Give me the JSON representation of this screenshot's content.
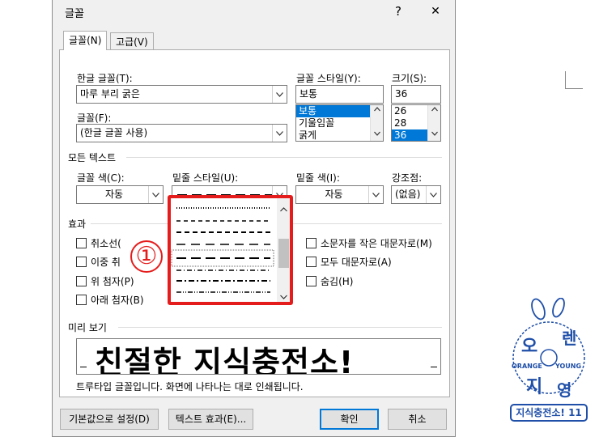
{
  "dialog": {
    "title": "글꼴",
    "help": "?",
    "close": "✕"
  },
  "tabs": [
    {
      "label": "글꼴(N)",
      "active": true
    },
    {
      "label": "고급(V)",
      "active": false
    }
  ],
  "hangul_font": {
    "label": "한글 글꼴(T):",
    "value": "마루 부리 굵은"
  },
  "font": {
    "label": "글꼴(F):",
    "value": "(한글 글꼴 사용)"
  },
  "font_style": {
    "label": "글꼴 스타일(Y):",
    "value": "보통",
    "options": [
      "보통",
      "기울임꼴",
      "굵게"
    ],
    "selected_index": 0
  },
  "size": {
    "label": "크기(S):",
    "value": "36",
    "options": [
      "26",
      "28",
      "36"
    ],
    "selected_index": 2
  },
  "all_text": {
    "header": "모든 텍스트"
  },
  "font_color": {
    "label": "글꼴 색(C):",
    "value": "자동"
  },
  "underline_style": {
    "label": "밑줄 스타일(U):"
  },
  "underline_color": {
    "label": "밑줄 색(I):",
    "value": "자동"
  },
  "emphasis": {
    "label": "강조점:",
    "value": "(없음)"
  },
  "effects": {
    "header": "효과",
    "left": [
      {
        "label": "취소선(",
        "checked": false
      },
      {
        "label": "이중 취",
        "checked": false
      },
      {
        "label": "위 첨자(P)",
        "checked": false
      },
      {
        "label": "아래 첨자(B)",
        "checked": false
      }
    ],
    "right": [
      {
        "label": "소문자를 작은 대문자로(M)",
        "checked": false
      },
      {
        "label": "모두 대문자로(A)",
        "checked": false
      },
      {
        "label": "숨김(H)",
        "checked": false
      }
    ]
  },
  "preview": {
    "header": "미리 보기",
    "text": "친절한 지식충전소!",
    "note": "트루타입 글꼴입니다. 화면에 나타나는 대로 인쇄됩니다."
  },
  "buttons": {
    "default": "기본값으로 설정(D)",
    "text_effects": "텍스트 효과(E)...",
    "ok": "확인",
    "cancel": "취소"
  },
  "annotation": {
    "marker": "①",
    "color": "#e51c1c"
  },
  "watermark": {
    "top_word": "오",
    "top_word2": "렌",
    "left_word": "ORANGE",
    "right_word": "YOUNG",
    "bottom_word": "지",
    "bottom_word2": "영",
    "badge": "지식충전소! 11",
    "brand_color": "#1f4fa8"
  },
  "colors": {
    "selection": "#0078d7",
    "dialog_bg": "#f0f0f0"
  }
}
